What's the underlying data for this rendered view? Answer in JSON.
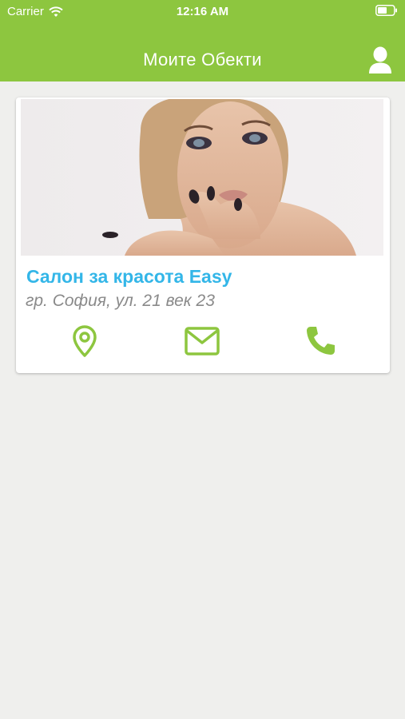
{
  "status_bar": {
    "carrier": "Carrier",
    "time": "12:16 AM"
  },
  "nav": {
    "title": "Моите Обекти"
  },
  "salon": {
    "name": "Салон за красота Easy",
    "address": "гр. София, ул. 21 век 23"
  },
  "colors": {
    "accent_green": "#8dc63f",
    "title_blue": "#33b6e8",
    "address_gray": "#8a8a8a",
    "background": "#efefed"
  },
  "icons": {
    "profile": "user-icon",
    "location": "map-pin-icon",
    "mail": "envelope-icon",
    "phone": "phone-icon"
  }
}
